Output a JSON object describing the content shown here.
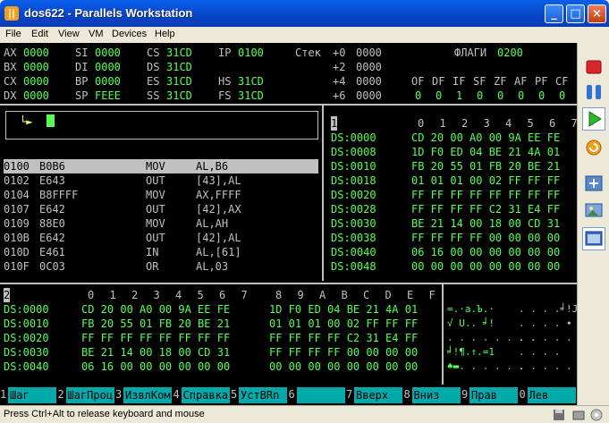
{
  "window": {
    "title": "dos622 - Parallels Workstation",
    "icon": "parallels-icon"
  },
  "menu": [
    "File",
    "Edit",
    "View",
    "VM",
    "Devices",
    "Help"
  ],
  "registers": [
    [
      "AX",
      "0000",
      "SI",
      "0000",
      "CS",
      "31CD",
      "IP",
      "0100"
    ],
    [
      "BX",
      "0000",
      "DI",
      "0000",
      "DS",
      "31CD",
      "",
      ""
    ],
    [
      "CX",
      "0000",
      "BP",
      "0000",
      "ES",
      "31CD",
      "HS",
      "31CD"
    ],
    [
      "DX",
      "0000",
      "SP",
      "FEEE",
      "SS",
      "31CD",
      "FS",
      "31CD"
    ]
  ],
  "stack": {
    "label": "Стек",
    "rows": [
      [
        "+0",
        "0000"
      ],
      [
        "+2",
        "0000"
      ],
      [
        "+4",
        "0000"
      ],
      [
        "+6",
        "0000"
      ]
    ]
  },
  "flags": {
    "label": "ФЛАГИ",
    "value": "0200",
    "names": [
      "OF",
      "DF",
      "IF",
      "SF",
      "ZF",
      "AF",
      "PF",
      "CF"
    ],
    "values": [
      "0",
      "0",
      "1",
      "0",
      "0",
      "0",
      "0",
      "0"
    ]
  },
  "command_prompt": "└►",
  "disasm": [
    [
      "0100",
      "B0B6",
      "MOV",
      "AL,B6"
    ],
    [
      "0102",
      "E643",
      "OUT",
      "[43],AL"
    ],
    [
      "0104",
      "B8FFFF",
      "MOV",
      "AX,FFFF"
    ],
    [
      "0107",
      "E642",
      "OUT",
      "[42],AX"
    ],
    [
      "0109",
      "88E0",
      "MOV",
      "AL,AH"
    ],
    [
      "010B",
      "E642",
      "OUT",
      "[42],AL"
    ],
    [
      "010D",
      "E461",
      "IN",
      "AL,[61]"
    ],
    [
      "010F",
      "0C03",
      "OR",
      "AL,03"
    ]
  ],
  "dump1": {
    "num": "1",
    "header": [
      "0",
      "1",
      "2",
      "3",
      "4",
      "5",
      "6",
      "7"
    ],
    "rows": [
      [
        "DS:0000",
        "CD 20 00 A0 00 9A EE FE"
      ],
      [
        "DS:0008",
        "1D F0 ED 04 BE 21 4A 01"
      ],
      [
        "DS:0010",
        "FB 20 55 01 FB 20 BE 21"
      ],
      [
        "DS:0018",
        "01 01 01 00 02 FF FF FF"
      ],
      [
        "DS:0020",
        "FF FF FF FF FF FF FF FF"
      ],
      [
        "DS:0028",
        "FF FF FF FF C2 31 E4 FF"
      ],
      [
        "DS:0030",
        "BE 21 14 00 18 00 CD 31"
      ],
      [
        "DS:0038",
        "FF FF FF FF 00 00 00 00"
      ],
      [
        "DS:0040",
        "06 16 00 00 00 00 00 00"
      ],
      [
        "DS:0048",
        "00 00 00 00 00 00 00 00"
      ]
    ]
  },
  "dump2": {
    "num": "2",
    "header": [
      "0",
      "1",
      "2",
      "3",
      "4",
      "5",
      "6",
      "7",
      "8",
      "9",
      "A",
      "B",
      "C",
      "D",
      "E",
      "F"
    ],
    "rows": [
      [
        "DS:0000",
        "CD 20 00 A0 00 9A EE FE",
        "1D F0 ED 04 BE 21 4A 01",
        "=.·a.Ъ.·",
        ". . . .╛!J."
      ],
      [
        "DS:0010",
        "FB 20 55 01 FB 20 BE 21",
        "01 01 01 00 02 FF FF FF",
        "√ U.. ╛!",
        ". . . . ∙ ∙"
      ],
      [
        "DS:0020",
        "FF FF FF FF FF FF FF FF",
        "FF FF FF FF C2 31 E4 FF",
        ". . . . . . . .",
        ". . . . . . 1 ."
      ],
      [
        "DS:0030",
        "BE 21 14 00 18 00 CD 31",
        "FF FF FF FF 00 00 00 00",
        "╛!¶.↑.=1",
        ". . . ."
      ],
      [
        "DS:0040",
        "06 16 00 00 00 00 00 00",
        "00 00 00 00 00 00 00 00",
        "♠▬. . . . . .",
        ". . . . . . . ."
      ]
    ]
  },
  "fkeys": [
    [
      "1",
      "Шаг"
    ],
    [
      "2",
      "ШагПроц"
    ],
    [
      "3",
      "ИзвлКом"
    ],
    [
      "4",
      "Справка"
    ],
    [
      "5",
      "УстBRn"
    ],
    [
      "6",
      ""
    ],
    [
      "7",
      "Вверх"
    ],
    [
      "8",
      "Вниз"
    ],
    [
      "9",
      "Прав"
    ],
    [
      "0",
      "Лев"
    ]
  ],
  "status": "Press Ctrl+Alt to release keyboard and mouse",
  "colors": {
    "accent": "#0A5FEB",
    "terminal_bg": "#000000",
    "terminal_green": "#55FF55",
    "terminal_gray": "#C0C0C0",
    "fkey_bg": "#00AAAA"
  },
  "sidebar_icons": [
    "stop-icon",
    "pause-icon",
    "play-icon",
    "reset-icon",
    "fullscreen-icon",
    "screenshot-icon",
    "window-icon"
  ]
}
